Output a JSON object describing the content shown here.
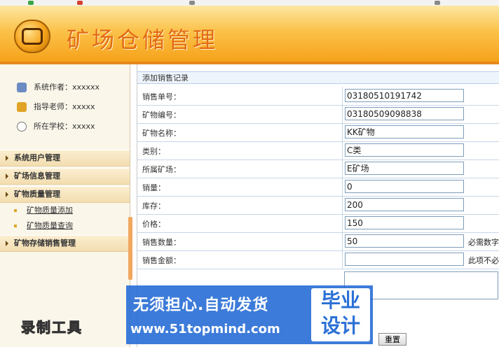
{
  "header": {
    "title": "矿场仓储管理"
  },
  "info": [
    {
      "label": "系统作者：",
      "value": "xxxxxx",
      "icon": "user-icon"
    },
    {
      "label": "指导老师：",
      "value": "xxxxx",
      "icon": "teacher-icon"
    },
    {
      "label": "所在学校：",
      "value": "xxxxx",
      "icon": "school-icon"
    }
  ],
  "menu": {
    "items": [
      {
        "label": "系统用户管理"
      },
      {
        "label": "矿场信息管理"
      },
      {
        "label": "矿物质量管理"
      },
      {
        "label": "矿物存储销售管理"
      }
    ],
    "sub_items": [
      {
        "label": "矿物质量添加"
      },
      {
        "label": "矿物质量查询"
      }
    ]
  },
  "form": {
    "caption": "添加销售记录",
    "rows": [
      {
        "label": "销售单号：",
        "value": "03180510191742"
      },
      {
        "label": "矿物编号：",
        "value": "03180509098838"
      },
      {
        "label": "矿物名称：",
        "value": "KK矿物"
      },
      {
        "label": "类别：",
        "value": "C类"
      },
      {
        "label": "所属矿场：",
        "value": "E矿场"
      },
      {
        "label": "销量：",
        "value": "0"
      },
      {
        "label": "库存：",
        "value": "200"
      },
      {
        "label": "价格：",
        "value": "150"
      },
      {
        "label": "销售数量：",
        "value": "50",
        "note": "必需数字"
      },
      {
        "label": "销售金额：",
        "value": "",
        "note": "此项不必"
      }
    ],
    "reset_label": "重置"
  },
  "banner": {
    "line1": "无须担心.自动发货",
    "line2": "www.51topmind.com",
    "box1": "毕业",
    "box2": "设计"
  },
  "watermark": "录制工具"
}
